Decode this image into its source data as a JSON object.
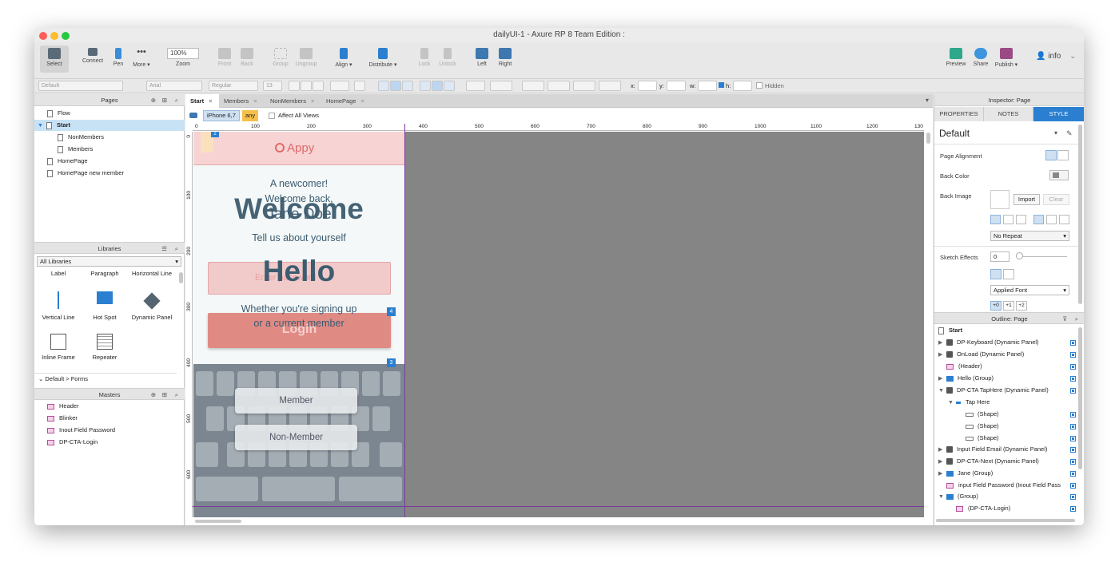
{
  "window": {
    "title": "dailyUI-1 - Axure RP 8 Team Edition :"
  },
  "toolbar": {
    "select": "Select",
    "connect": "Connect",
    "pen": "Pen",
    "more": "More ▾",
    "zoom_value": "100%",
    "zoom": "Zoom",
    "front": "Front",
    "back": "Back",
    "group": "Group",
    "ungroup": "Ungroup",
    "align": "Align ▾",
    "distribute": "Distribute ▾",
    "lock": "Lock",
    "unlock": "Unlock",
    "left": "Left",
    "right": "Right",
    "preview": "Preview",
    "share": "Share",
    "publish": "Publish ▾",
    "user": "info"
  },
  "stylebar": {
    "style": "Default",
    "font": "Arial",
    "weight": "Regular",
    "size": "13",
    "x": "x:",
    "y": "y:",
    "w": "w:",
    "h": "h:",
    "hidden": "Hidden"
  },
  "pages": {
    "title": "Pages",
    "items": [
      {
        "label": "Flow"
      },
      {
        "label": "Start"
      },
      {
        "label": "NonMembers"
      },
      {
        "label": "Members"
      },
      {
        "label": "HomePage"
      },
      {
        "label": "HomePage new member"
      }
    ]
  },
  "libraries": {
    "title": "Libraries",
    "selected": "All Libraries",
    "top_labels": [
      "Label",
      "Paragraph",
      "Horizontal Line"
    ],
    "items": [
      {
        "label": "Vertical Line"
      },
      {
        "label": "Hot Spot"
      },
      {
        "label": "Dynamic Panel"
      },
      {
        "label": "Inline Frame"
      },
      {
        "label": "Repeater"
      }
    ],
    "group": "Default > Forms"
  },
  "masters": {
    "title": "Masters",
    "items": [
      {
        "label": "Header"
      },
      {
        "label": "Blinker"
      },
      {
        "label": "Inout Field Password"
      },
      {
        "label": "DP-CTA-Login"
      }
    ]
  },
  "tabs": [
    {
      "label": "Start"
    },
    {
      "label": "Members"
    },
    {
      "label": "NonMembers"
    },
    {
      "label": "HomePage"
    }
  ],
  "adaptive": {
    "device": "iPhone 6,7",
    "any": "any",
    "affect": "Affect All Views"
  },
  "ruler": {
    "h": [
      "0",
      "100",
      "200",
      "300",
      "400",
      "500",
      "600",
      "700",
      "800",
      "900",
      "1000",
      "1100",
      "1200",
      "130"
    ],
    "v": [
      "0",
      "100",
      "200",
      "300",
      "400",
      "500",
      "600"
    ]
  },
  "mockup": {
    "logo": "Appy",
    "newcomer": "A newcomer!",
    "welcome_back": "Welcome back,",
    "jane": "Jane Doe",
    "welcome": "Welcome",
    "tell": "Tell us about yourself",
    "hello": "Hello",
    "input_ph": "Enter password",
    "signing1": "Whether you're signing up",
    "signing2": "or a current member",
    "login": "Login",
    "member": "Member",
    "non_member": "Non-Member",
    "badge4": "4",
    "badge3": "3",
    "badge2": "2"
  },
  "inspector": {
    "title": "Inspector: Page",
    "tabs": [
      "PROPERTIES",
      "NOTES",
      "STYLE"
    ],
    "style_name": "Default",
    "page_alignment": "Page Alignment",
    "back_color": "Back Color",
    "back_image": "Back Image",
    "import": "Import",
    "clear": "Clear",
    "repeat": "No Repeat",
    "sketch": "Sketch Effects",
    "sketch_val": "0",
    "applied_font": "Applied Font",
    "font_btns": [
      "+0",
      "+1",
      "+2"
    ]
  },
  "outline": {
    "title": "Outline: Page",
    "root": "Start",
    "items": [
      {
        "label": "DP-Keyboard (Dynamic Panel)"
      },
      {
        "label": "OnLoad (Dynamic Panel)"
      },
      {
        "label": "(Header)"
      },
      {
        "label": "Hello (Group)"
      },
      {
        "label": "DP-CTA TapHere (Dynamic Panel)"
      },
      {
        "label": "Tap Here"
      },
      {
        "label": "(Shape)"
      },
      {
        "label": "(Shape)"
      },
      {
        "label": "(Shape)"
      },
      {
        "label": "Input Field Email (Dynamic Panel)"
      },
      {
        "label": "DP-CTA-Next (Dynamic Panel)"
      },
      {
        "label": "Jane (Group)"
      },
      {
        "label": "input Field Password (Inout Field Pass"
      },
      {
        "label": "(Group)"
      },
      {
        "label": "(DP-CTA-Login)"
      }
    ]
  }
}
